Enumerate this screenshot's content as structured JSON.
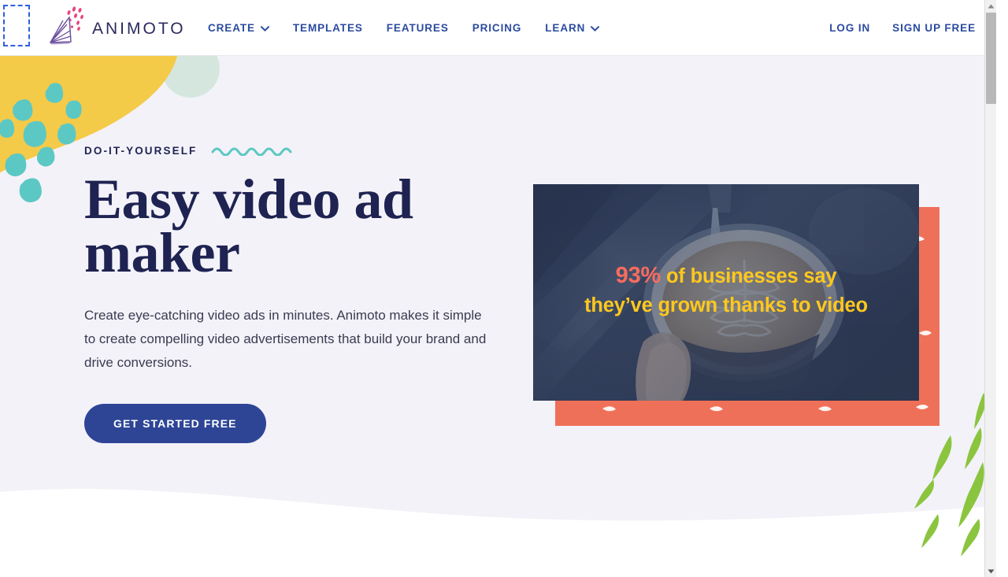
{
  "brand": {
    "name": "ANIMOTO",
    "logo_icon": "animoto-fan-logo",
    "confetti_icon": "pink-dots-confetti"
  },
  "nav": {
    "items": [
      {
        "label": "CREATE",
        "has_dropdown": true,
        "icon": "chevron-down-icon"
      },
      {
        "label": "TEMPLATES",
        "has_dropdown": false
      },
      {
        "label": "FEATURES",
        "has_dropdown": false
      },
      {
        "label": "PRICING",
        "has_dropdown": false
      },
      {
        "label": "LEARN",
        "has_dropdown": true,
        "icon": "chevron-down-icon"
      }
    ],
    "auth": [
      {
        "label": "LOG IN"
      },
      {
        "label": "SIGN UP FREE"
      }
    ]
  },
  "hero": {
    "eyebrow": "DO-IT-YOURSELF",
    "squiggle_icon": "teal-squiggle-underline",
    "title": "Easy video ad maker",
    "subtitle": "Create eye-catching video ads in minutes. Animoto makes it simple to create compelling video advertisements that build your brand and drive conversions.",
    "cta_label": "GET STARTED FREE"
  },
  "media": {
    "caption_stat": "93%",
    "caption_line1_rest": " of businesses say",
    "caption_line2": "they’ve grown thanks to video",
    "photo_alt": "hand holding cup of coffee with latte art",
    "photo_icon": "latte-art-coffee-cup"
  },
  "decor": {
    "mint_circle_icon": "mint-circle-shape",
    "yellow_blob_icon": "yellow-blob-shape",
    "teal_confetti_icon": "teal-confetti-squares",
    "green_grass_icon": "green-grass-strokes",
    "coral_pattern_icon": "coral-feather-pattern",
    "wave_divider_icon": "wave-divider-shape"
  },
  "scrollbar": {
    "up_arrow_icon": "scroll-up-arrow-icon",
    "down_arrow_icon": "scroll-down-arrow-icon"
  },
  "colors": {
    "nav_blue": "#2b4ba0",
    "navy": "#1f2352",
    "cta_blue": "#2e4596",
    "hero_bg": "#f3f2f8",
    "teal": "#5cc8c4",
    "yellow": "#f4ca49",
    "coral": "#ef7058",
    "caption_yellow": "#ffc81e",
    "stat_coral": "#f86c5e",
    "mint": "#d5e6de",
    "green": "#8bc53f",
    "pink": "#e8447f"
  }
}
